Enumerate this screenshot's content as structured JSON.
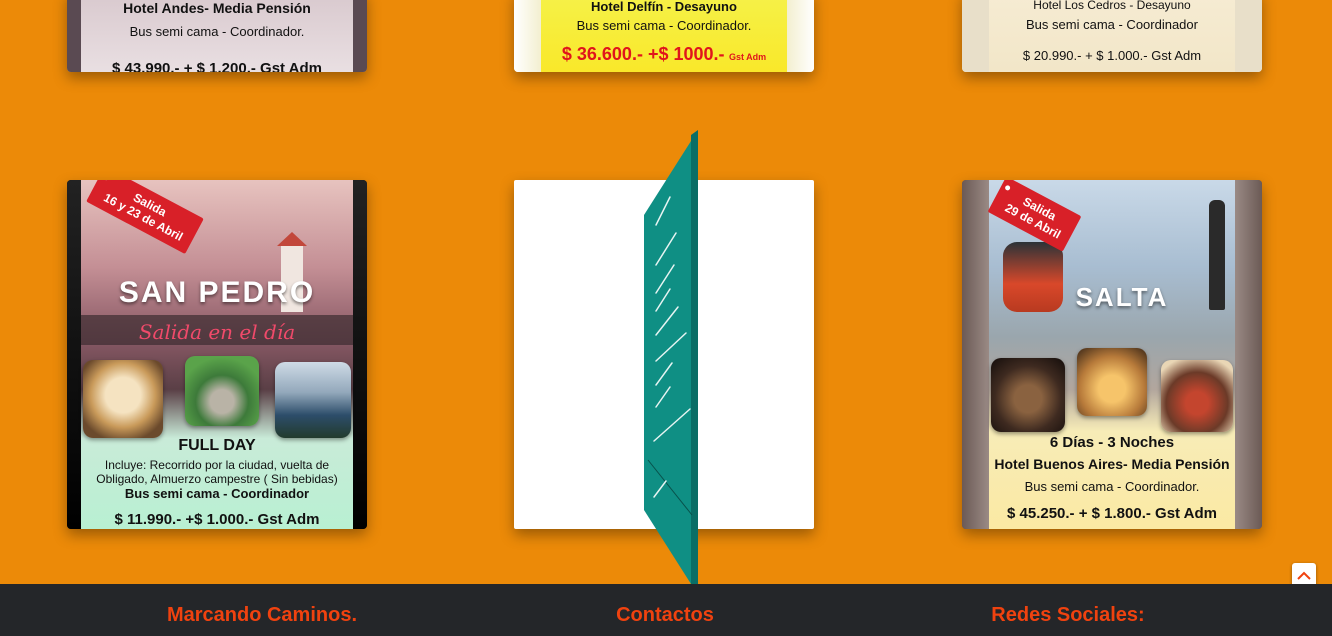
{
  "top_cards": [
    {
      "hotel": "Hotel Andes- Media Pensión",
      "bus": "Bus semi cama - Coordinador.",
      "price": "$ 43.990.- + $ 1.200.- Gst Adm"
    },
    {
      "hotel": "Hotel Delfín - Desayuno",
      "bus": "Bus semi cama - Coordinador.",
      "price": "$ 36.600.- +$ 1000.-",
      "price_suffix": "Gst Adm"
    },
    {
      "hotel": "Hotel Los Cedros - Desayuno",
      "bus": "Bus semi cama - Coordinador",
      "price": "$ 20.990.- + $ 1.000.- Gst Adm"
    }
  ],
  "san_pedro": {
    "tag_line1": "Salida",
    "tag_line2": "16 y 23 de Abril",
    "title": "SAN PEDRO",
    "script": "Salida en el día",
    "full_day": "FULL DAY",
    "includes_line1": "Incluye: Recorrido por la ciudad, vuelta de",
    "includes_line2": "Obligado, Almuerzo campestre ( Sin bebidas)",
    "bus": "Bus semi cama - Coordinador",
    "price": "$ 11.990.- +$ 1.000.- Gst Adm"
  },
  "salta": {
    "tag_line1": "Salida",
    "tag_line2": "29 de Abril",
    "title": "SALTA",
    "days": "6 Días - 3 Noches",
    "hotel": "Hotel Buenos Aires- Media Pensión",
    "bus": "Bus semi cama - Coordinador.",
    "price": "$ 45.250.- + $ 1.800.- Gst Adm"
  },
  "footer": {
    "col1": "Marcando Caminos.",
    "col2": "Contactos",
    "col3": "Redes Sociales:"
  },
  "colors": {
    "background": "#ec8a08",
    "footer_bg": "#242629",
    "footer_title": "#f0420f",
    "flip_teal": "#0f8f84",
    "tag_red": "#d82028"
  },
  "icons": {
    "back_to_top": "chevron-up-icon"
  }
}
